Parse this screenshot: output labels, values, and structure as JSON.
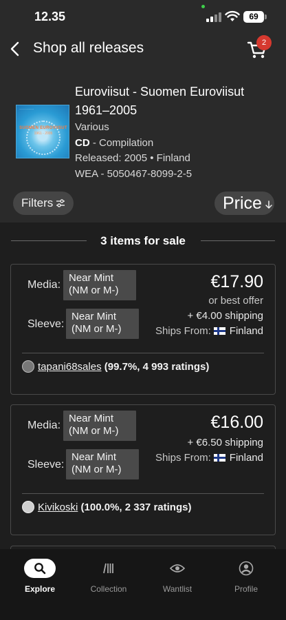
{
  "status_bar": {
    "time": "12.35",
    "battery": "69"
  },
  "header": {
    "title": "Shop all releases",
    "cart_count": "2"
  },
  "release": {
    "title": "Euroviisut - Suomen Euroviisut 1961–2005",
    "artist": "Various",
    "format_bold": "CD",
    "format_rest": " - Compilation",
    "released": "Released: 2005 • Finland",
    "label": "WEA - 5050467-8099-2-5",
    "cover_title": "SUOMEN EUROVIISUT",
    "cover_years": "1961 - 2005"
  },
  "filters": {
    "filters_label": "Filters",
    "price_label": "Price"
  },
  "section_title": "3 items for sale",
  "listings": [
    {
      "media_label": "Media:",
      "media_condition": "Near Mint (NM or M-)",
      "sleeve_label": "Sleeve:",
      "sleeve_condition": "Near Mint (NM or M-)",
      "price": "€17.90",
      "offer": "or best offer",
      "shipping": "+ €4.00 shipping",
      "ships_from_label": "Ships From:",
      "ships_from": "Finland",
      "seller": "tapani68sales",
      "rating": "(99.7%, 4 993 ratings)"
    },
    {
      "media_label": "Media:",
      "media_condition": "Near Mint (NM or M-)",
      "sleeve_label": "Sleeve:",
      "sleeve_condition": "Near Mint (NM or M-)",
      "price": "€16.00",
      "shipping": "+ €6.50 shipping",
      "ships_from_label": "Ships From:",
      "ships_from": "Finland",
      "seller": "Kivikoski",
      "rating": "(100.0%, 2 337 ratings)"
    }
  ],
  "bottom_nav": [
    {
      "label": "Explore",
      "icon": "search-icon",
      "active": true
    },
    {
      "label": "Collection",
      "icon": "collection-icon"
    },
    {
      "label": "Wantlist",
      "icon": "eye-icon"
    },
    {
      "label": "Profile",
      "icon": "profile-icon"
    }
  ],
  "colors": {
    "background": "#1e1e1e",
    "panel": "#2a2a2a",
    "badge": "#d6392f",
    "chip": "#454545"
  }
}
